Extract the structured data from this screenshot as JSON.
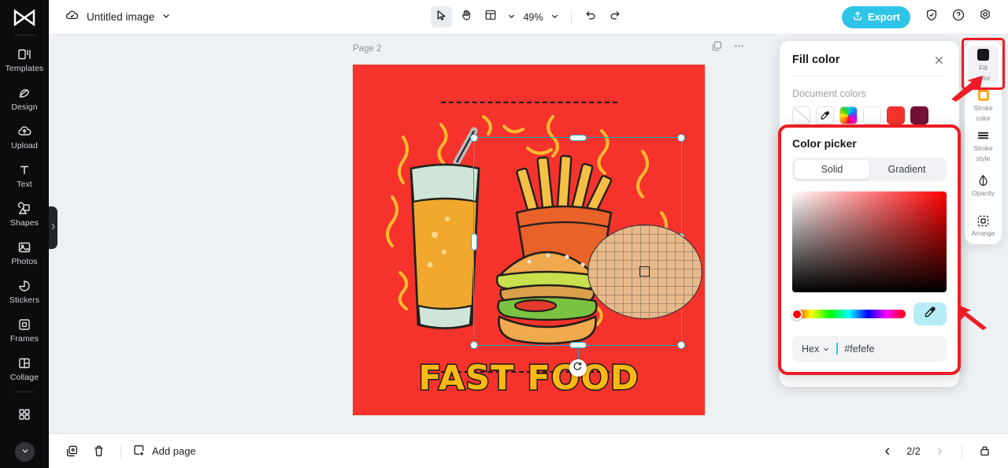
{
  "sidebar": {
    "logo_name": "capcut-logo",
    "items": [
      {
        "label": "Templates",
        "icon": "templates-icon"
      },
      {
        "label": "Design",
        "icon": "design-icon"
      },
      {
        "label": "Upload",
        "icon": "upload-icon"
      },
      {
        "label": "Text",
        "icon": "text-icon"
      },
      {
        "label": "Shapes",
        "icon": "shapes-icon"
      },
      {
        "label": "Photos",
        "icon": "photos-icon"
      },
      {
        "label": "Stickers",
        "icon": "stickers-icon"
      },
      {
        "label": "Frames",
        "icon": "frames-icon"
      },
      {
        "label": "Collage",
        "icon": "collage-icon"
      }
    ],
    "more_icon": "apps-grid-icon",
    "scroll_icon": "chevron-down-icon",
    "panel_tab_icon": "chevron-right-icon"
  },
  "topbar": {
    "cloud_icon": "cloud-save-icon",
    "doc_title": "Untitled image",
    "doc_chevron": "chevron-down-icon",
    "tools": {
      "select_icon": "cursor-select-icon",
      "hand_icon": "hand-pan-icon",
      "layout_icon": "layout-grid-icon",
      "layout_chevron": "chevron-down-icon",
      "zoom_value": "49%",
      "zoom_chevron": "chevron-down-icon",
      "undo_icon": "undo-icon",
      "redo_icon": "redo-icon"
    },
    "export_label": "Export",
    "export_icon": "upload-export-icon",
    "export_color": "#2ec4e6",
    "shield_icon": "shield-check-icon",
    "help_icon": "help-circle-icon",
    "settings_icon": "settings-gear-icon"
  },
  "canvas": {
    "page_label": "Page 2",
    "duplicate_page_icon": "duplicate-icon",
    "more_page_icon": "more-horizontal-icon",
    "artboard_color": "#F5332C",
    "artwork_text": "FAST FOOD",
    "artwork_text_color": "#FDB913",
    "float_toolbar": {
      "duplicate_icon": "duplicate-icon",
      "more_icon": "more-horizontal-icon"
    },
    "selection": {
      "border_color": "#2aa8c4",
      "rotate_icon": "rotate-icon"
    },
    "magnifier_icon": "eyedropper-magnifier"
  },
  "bottombar": {
    "duplicate_icon": "duplicate-page-icon",
    "delete_icon": "trash-icon",
    "add_page_label": "Add page",
    "add_page_icon": "add-page-icon",
    "prev_icon": "chevron-left-icon",
    "page_indicator": "2/2",
    "next_icon": "chevron-right-icon",
    "grid_view_icon": "page-manager-icon"
  },
  "fill_panel": {
    "title": "Fill color",
    "close_icon": "close-icon",
    "section_label": "Document colors",
    "swatches": [
      {
        "name": "no-color-swatch",
        "color": "transparent"
      },
      {
        "name": "eyedropper-swatch",
        "color": "#ffffff"
      },
      {
        "name": "rainbow-swatch",
        "color": "rainbow"
      },
      {
        "name": "white-swatch",
        "color": "#ffffff"
      },
      {
        "name": "red-swatch",
        "color": "#F5332C"
      },
      {
        "name": "maroon-swatch",
        "color": "#751137"
      }
    ]
  },
  "color_picker": {
    "title": "Color picker",
    "tab_solid": "Solid",
    "tab_gradient": "Gradient",
    "active_tab": "Solid",
    "hue_color": "#ff0000",
    "eyedropper_icon": "eyedropper-icon",
    "eyedropper_bg": "#b6ecf5",
    "mode_label": "Hex",
    "mode_chevron": "chevron-down-icon",
    "hex_value": "#fefefe"
  },
  "right_rail": {
    "items": [
      {
        "label": "Fill\ncolor",
        "label1": "Fill",
        "label2": "color",
        "icon": "fill-color-icon",
        "active": true
      },
      {
        "label1": "Stroke",
        "label2": "color",
        "icon": "stroke-color-icon",
        "active": false
      },
      {
        "label1": "Stroke",
        "label2": "style",
        "icon": "stroke-style-icon",
        "active": false
      },
      {
        "label1": "Opacity",
        "label2": "",
        "icon": "opacity-icon",
        "active": false
      },
      {
        "label1": "Arrange",
        "label2": "",
        "icon": "arrange-icon",
        "active": false
      }
    ]
  },
  "annotations": {
    "highlight_color": "#ED1C24",
    "arrow_fill_name": "red-arrow-to-fill-color",
    "arrow_dropper_name": "red-arrow-to-eyedropper"
  }
}
